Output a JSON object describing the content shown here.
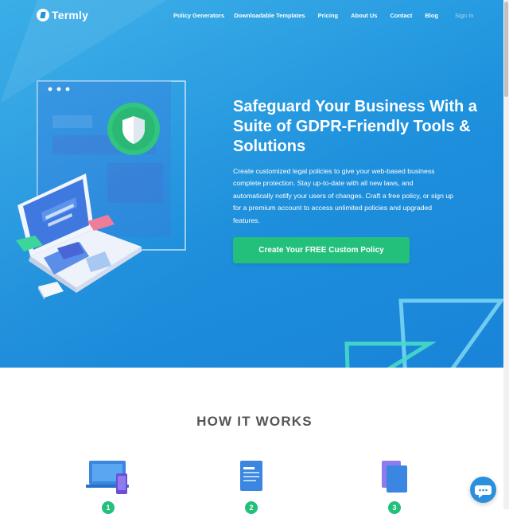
{
  "brand": {
    "name": "Termly"
  },
  "nav": {
    "links": [
      {
        "label": "Policy Generators"
      },
      {
        "label": "Downloadable Templates"
      },
      {
        "label": "Pricing"
      },
      {
        "label": "About Us"
      },
      {
        "label": "Contact"
      },
      {
        "label": "Blog"
      }
    ],
    "signin": "Sign In"
  },
  "hero": {
    "headline": "Safeguard Your Business With a Suite of GDPR-Friendly Tools & Solutions",
    "description": "Create customized legal policies to give your web-based business complete protection. Stay up-to-date with all new laws, and automatically notify your users of changes. Craft a free policy, or sign up for a premium account to access unlimited policies and upgraded features.",
    "cta": "Create Your FREE Custom Policy"
  },
  "how_it_works": {
    "title": "HOW IT WORKS",
    "steps": [
      {
        "number": "1",
        "icon": "devices-icon"
      },
      {
        "number": "2",
        "icon": "document-icon"
      },
      {
        "number": "3",
        "icon": "documents-stack-icon"
      }
    ]
  },
  "chat": {
    "icon": "chat-icon"
  },
  "colors": {
    "hero_blue": "#1d8fdc",
    "accent_green": "#22c07b",
    "text_gray": "#555555"
  }
}
